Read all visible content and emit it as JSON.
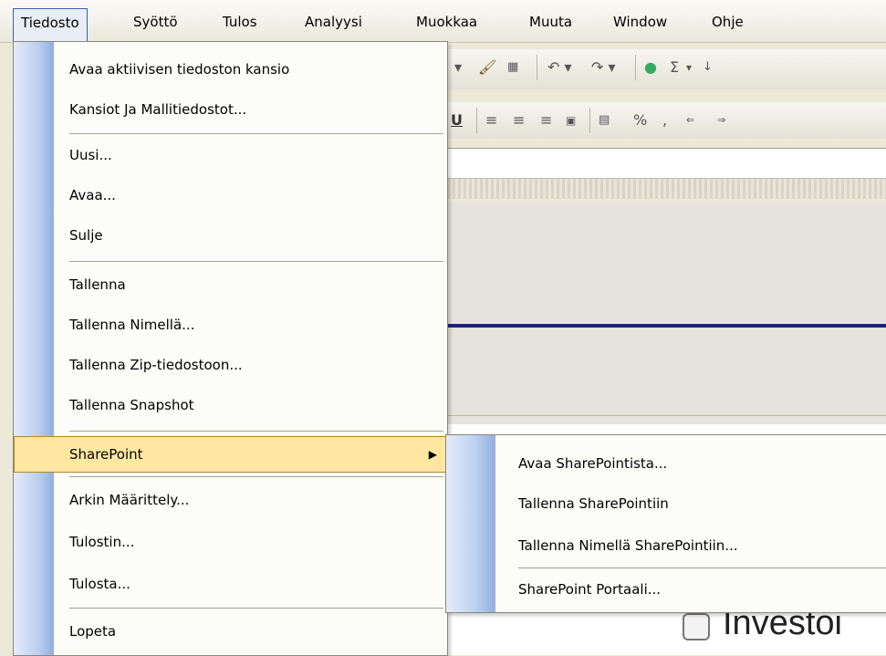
{
  "menubar": {
    "items": [
      {
        "label": "Tiedosto",
        "active": true
      },
      {
        "label": "Syöttö"
      },
      {
        "label": "Tulos"
      },
      {
        "label": "Analyysi"
      },
      {
        "label": "Muokkaa"
      },
      {
        "label": "Muuta"
      },
      {
        "label": "Window"
      },
      {
        "label": "Ohje"
      }
    ]
  },
  "file_menu": {
    "items": [
      {
        "label": "Avaa aktiivisen tiedoston kansio"
      },
      {
        "label": "Kansiot Ja Mallitiedostot..."
      },
      {
        "label": "Uusi..."
      },
      {
        "label": "Avaa..."
      },
      {
        "label": "Sulje"
      },
      {
        "label": "Tallenna"
      },
      {
        "label": "Tallenna Nimellä..."
      },
      {
        "label": "Tallenna Zip-tiedostoon..."
      },
      {
        "label": "Tallenna Snapshot"
      },
      {
        "label": "SharePoint",
        "highlighted": true,
        "has_submenu": true
      },
      {
        "label": "Arkin Määrittely..."
      },
      {
        "label": "Tulostin..."
      },
      {
        "label": "Tulosta..."
      },
      {
        "label": "Lopeta"
      }
    ]
  },
  "sharepoint_submenu": {
    "items": [
      {
        "label": "Avaa SharePointista..."
      },
      {
        "label": "Tallenna SharePointiin"
      },
      {
        "label": "Tallenna Nimellä SharePointiin..."
      },
      {
        "label": "SharePoint Portaali..."
      }
    ]
  },
  "toolbar": {
    "row1": [
      "Σ"
    ],
    "row2": [
      "U",
      "%"
    ]
  },
  "content": {
    "checkbox_label": "Investoi"
  },
  "colors": {
    "highlight": "#ffe7a2",
    "gutter": "#93aedf",
    "navy_rule": "#1a237e"
  }
}
